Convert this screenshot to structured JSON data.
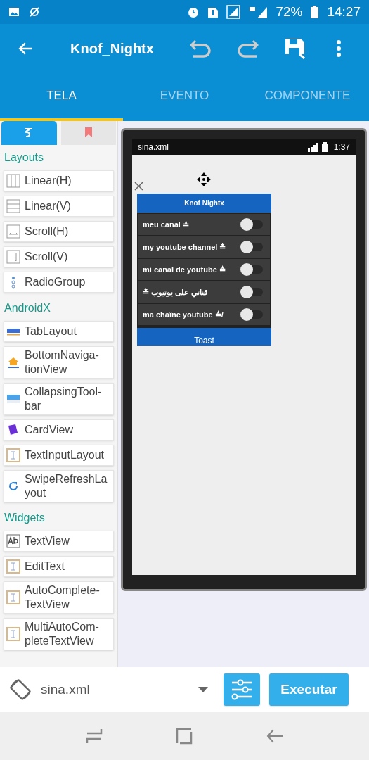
{
  "status_bar": {
    "battery": "72%",
    "time": "14:27"
  },
  "toolbar": {
    "title": "Knof_Nightx"
  },
  "tabs": [
    {
      "label": "TELA",
      "selected": true
    },
    {
      "label": "EVENTO",
      "selected": false
    },
    {
      "label": "COMPONENTE",
      "selected": false
    }
  ],
  "palette_tabs": [
    {
      "selected": true
    },
    {
      "selected": false
    }
  ],
  "palette": [
    {
      "kind": "header",
      "label": "Layouts"
    },
    {
      "kind": "item",
      "label": "Linear(H)"
    },
    {
      "kind": "item",
      "label": "Linear(V)"
    },
    {
      "kind": "item",
      "label": "Scroll(H)"
    },
    {
      "kind": "item",
      "label": "Scroll(V)"
    },
    {
      "kind": "item",
      "label": "RadioGroup"
    },
    {
      "kind": "header",
      "label": "AndroidX"
    },
    {
      "kind": "item",
      "label": "TabLayout"
    },
    {
      "kind": "item",
      "label": "BottomNaviga-tionView"
    },
    {
      "kind": "item",
      "label": "CollapsingTool-bar"
    },
    {
      "kind": "item",
      "label": "CardView"
    },
    {
      "kind": "item",
      "label": "TextInputLayout"
    },
    {
      "kind": "item",
      "label": "SwipeRefreshLayout"
    },
    {
      "kind": "header",
      "label": "Widgets"
    },
    {
      "kind": "item",
      "label": "TextView"
    },
    {
      "kind": "item",
      "label": "EditText"
    },
    {
      "kind": "item",
      "label": "AutoComplete-TextView"
    },
    {
      "kind": "item",
      "label": "MultiAutoCom-pleteTextView"
    }
  ],
  "preview": {
    "file": "sina.xml",
    "time": "1:37",
    "card_title": "Knof Nightx",
    "switches": [
      {
        "label": "meu canal ≛",
        "on": false
      },
      {
        "label": "my youtube channel ≛",
        "on": false
      },
      {
        "label": "mi canal de youtube ≛",
        "on": false
      },
      {
        "label": "≛ قناتي على يوتيوب",
        "on": false
      },
      {
        "label": "ma chaîne youtube ≛/",
        "on": false
      }
    ],
    "button": "Toast"
  },
  "bottom_bar": {
    "file": "sina.xml",
    "run": "Executar"
  }
}
